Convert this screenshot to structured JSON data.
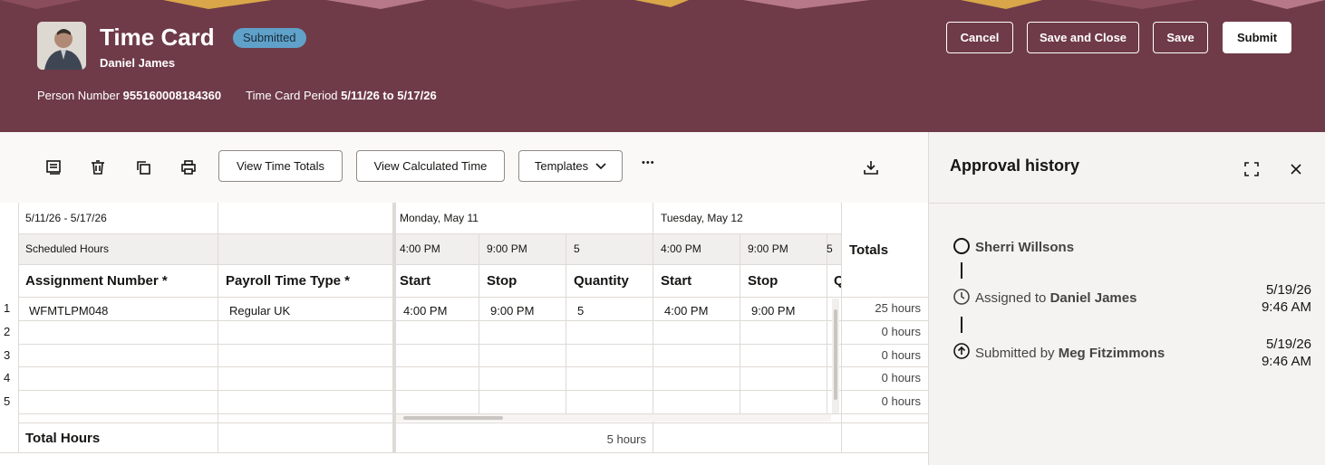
{
  "header": {
    "title": "Time Card",
    "status": "Submitted",
    "person_name": "Daniel James",
    "person_number_label": "Person Number",
    "person_number": "955160008184360",
    "period_label": "Time Card Period",
    "period": "5/11/26 to 5/17/26",
    "buttons": {
      "cancel": "Cancel",
      "save_close": "Save and Close",
      "save": "Save",
      "submit": "Submit"
    },
    "colors": {
      "background": "#6f3b48",
      "badge": "#5fa1c9"
    }
  },
  "toolbar": {
    "icons": [
      "comment-icon",
      "delete-icon",
      "copy-icon",
      "print-icon"
    ],
    "view_totals": "View Time Totals",
    "view_calculated": "View Calculated Time",
    "templates": "Templates",
    "more": "•••"
  },
  "grid": {
    "period_range": "5/11/26 - 5/17/26",
    "scheduled_label": "Scheduled Hours",
    "days": [
      {
        "label": "Monday, May 11",
        "sched_start": "4:00 PM",
        "sched_stop": "9:00 PM",
        "sched_qty": "5"
      },
      {
        "label": "Tuesday, May 12",
        "sched_start": "4:00 PM",
        "sched_stop": "9:00 PM",
        "sched_qty": "5"
      }
    ],
    "columns": {
      "assignment": "Assignment Number *",
      "payroll": "Payroll Time Type *",
      "start": "Start",
      "stop": "Stop",
      "quantity": "Quantity",
      "q_partial": "Q"
    },
    "totals_header": "Totals",
    "rows": [
      {
        "num": "1",
        "assignment": "WFMTLPM048",
        "payroll": "Regular UK",
        "mon_start": "4:00 PM",
        "mon_stop": "9:00 PM",
        "mon_qty": "5",
        "tue_start": "4:00 PM",
        "tue_stop": "9:00 PM",
        "total": "25 hours"
      },
      {
        "num": "2",
        "assignment": "",
        "payroll": "",
        "mon_start": "",
        "mon_stop": "",
        "mon_qty": "",
        "tue_start": "",
        "tue_stop": "",
        "total": "0 hours"
      },
      {
        "num": "3",
        "assignment": "",
        "payroll": "",
        "mon_start": "",
        "mon_stop": "",
        "mon_qty": "",
        "tue_start": "",
        "tue_stop": "",
        "total": "0 hours"
      },
      {
        "num": "4",
        "assignment": "",
        "payroll": "",
        "mon_start": "",
        "mon_stop": "",
        "mon_qty": "",
        "tue_start": "",
        "tue_stop": "",
        "total": "0 hours"
      },
      {
        "num": "5",
        "assignment": "",
        "payroll": "",
        "mon_start": "",
        "mon_stop": "",
        "mon_qty": "",
        "tue_start": "",
        "tue_stop": "",
        "total": "0 hours"
      }
    ],
    "total_hours_label": "Total Hours",
    "monday_total": "5 hours"
  },
  "approval": {
    "title": "Approval history",
    "entries": [
      {
        "name": "Sherri Willsons"
      },
      {
        "prefix": "Assigned to",
        "name": "Daniel James",
        "date": "5/19/26",
        "time": "9:46 AM"
      },
      {
        "prefix": "Submitted by",
        "name": "Meg Fitzimmons",
        "date": "5/19/26",
        "time": "9:46 AM"
      }
    ]
  }
}
